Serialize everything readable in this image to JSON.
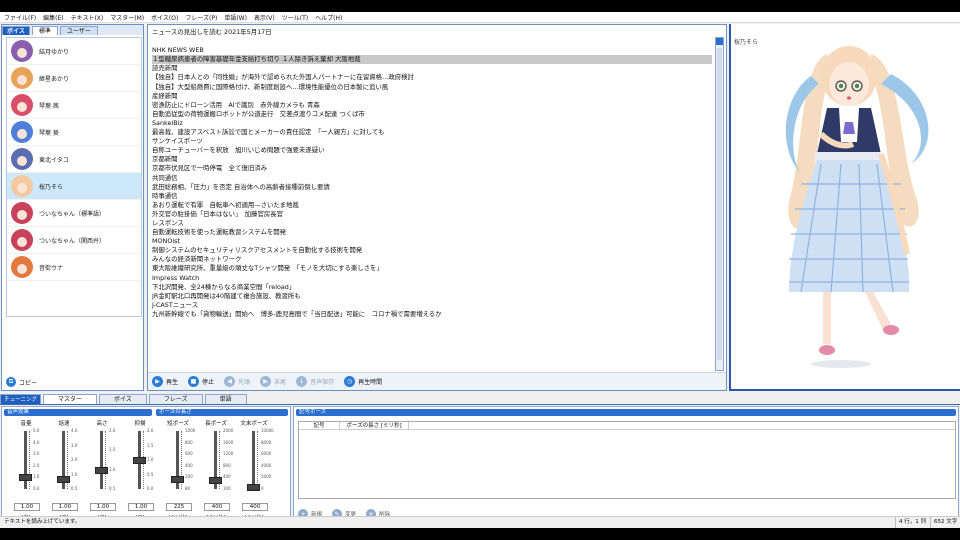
{
  "menu": [
    "ファイル(F)",
    "編集(E)",
    "テキスト(X)",
    "マスター(M)",
    "ボイス(O)",
    "フレーズ(P)",
    "単語(W)",
    "表示(V)",
    "ツール(T)",
    "ヘルプ(H)"
  ],
  "voice_panel": {
    "badge": "ボイス",
    "tabs": [
      "標準",
      "ユーザー"
    ],
    "voices": [
      {
        "name": "結月ゆかり",
        "color": "#8a5fb0"
      },
      {
        "name": "紲星あかり",
        "color": "#e8a35a"
      },
      {
        "name": "琴葉 茜",
        "color": "#d94f6a"
      },
      {
        "name": "琴葉 葵",
        "color": "#4f7fd9"
      },
      {
        "name": "東北イタコ",
        "color": "#5b6fb0"
      },
      {
        "name": "桜乃そら",
        "color": "#f3c9a0",
        "selected": true
      },
      {
        "name": "ついなちゃん（標準語）",
        "color": "#c8405a"
      },
      {
        "name": "ついなちゃん（関西弁）",
        "color": "#c8405a"
      },
      {
        "name": "音街ウナ",
        "color": "#e27a3f"
      }
    ],
    "copy_label": "コピー"
  },
  "editor": {
    "lines": [
      "ニュースの見出しを読む 2021年5月17日",
      "",
      "NHK NEWS WEB",
      "１型糖尿病患者の障害基礎年金支給打ち切り １人除き訴え棄却 大阪地裁",
      "読売新聞",
      "【独自】日本人との「同性婚」が海外で認められた外国人パートナーに在留資格…政府検討",
      "【独自】大型船燃費に国際格付け、新制度創設へ…環境性能優位の日本製に追い風",
      "産経新聞",
      "密漁防止にドローン活用　AIで識別　赤外線カメラも 青森",
      "自動追従型の荷物運搬ロボットが公道走行　交差点渡りコメ配達 つくば市",
      "SankeiBiz",
      "最高裁、建設アスベスト訴訟で国とメーカーの責任認定　「一人親方」に対しても",
      "サンケイスポーツ",
      "自称ユーチューバーを釈放　旭川いじめ問題で強要未遂疑い",
      "京都新聞",
      "京都市伏見区で一時停電　全て復旧済み",
      "共同通信",
      "武田総務相、「圧力」を否定 自治体への高齢者接種前倒し要請",
      "時事通信",
      "あおり運転で有罪　自転車へ初適用—さいたま地裁",
      "外交官の駐掛価「日本はない」　加藤官房長官",
      "レスポンス",
      "自動運転技術を使った運転教習システムを開発",
      "MONOist",
      "制御システムのセキュリティリスクアセスメントを自動化する技術を開発",
      "みんなの経済新聞ネットワーク",
      "東大阪維織研究所、重量級の頑丈なTシャツ開発　「モノを大切にする楽しさを」",
      "Impress Watch",
      "下北沢開発、全24棟からなる商業空間「reload」",
      "JR金町駅北口再開発は40階建て複合施設、教習所も",
      "J-CASTニュース",
      "九州新幹線でも「貨物輸送」開始へ　博多-鹿児島間で「当日配送」可能に　コロナ禍で需要増えるか"
    ],
    "buttons": [
      {
        "label": "再生",
        "icon": "play-icon",
        "glyph": "▶",
        "enabled": true
      },
      {
        "label": "停止",
        "icon": "stop-icon",
        "glyph": "■",
        "enabled": true
      },
      {
        "label": "先頭",
        "icon": "skip-back-icon",
        "glyph": "◀",
        "enabled": false
      },
      {
        "label": "末尾",
        "icon": "skip-forward-icon",
        "glyph": "▶",
        "enabled": false
      },
      {
        "label": "音声保存",
        "icon": "save-audio-icon",
        "glyph": "↓",
        "enabled": false
      },
      {
        "label": "再生時間",
        "icon": "timer-icon",
        "glyph": "◷",
        "enabled": true
      }
    ]
  },
  "character": {
    "name": "桜乃そら"
  },
  "tuning": {
    "badge": "チューニング",
    "tabs": [
      "マスター",
      "ボイス",
      "フレーズ",
      "単語"
    ],
    "section_voice": "音声効果",
    "section_pause": "ポーズの長さ",
    "sliders": [
      {
        "label": "音量",
        "value": "1.00",
        "unit": "[倍]",
        "ticks": [
          "5.0",
          "4.0",
          "3.0",
          "2.0",
          "1.0",
          "0.0"
        ],
        "level": 0.2
      },
      {
        "label": "話速",
        "value": "1.00",
        "unit": "[倍]",
        "ticks": [
          "4.0",
          "3.0",
          "2.0",
          "1.0",
          "0.5"
        ],
        "level": 0.17
      },
      {
        "label": "高さ",
        "value": "1.00",
        "unit": "[倍]",
        "ticks": [
          "2.0",
          "1.5",
          "1.0",
          "0.5"
        ],
        "level": 0.33
      },
      {
        "label": "抑揚",
        "value": "1.00",
        "unit": "[倍]",
        "ticks": [
          "2.0",
          "1.5",
          "1.0",
          "0.5",
          "0.0"
        ],
        "level": 0.5
      },
      {
        "label": "短ポーズ",
        "value": "225",
        "unit": "[ミリ秒]",
        "ticks": [
          "1000",
          "800",
          "600",
          "400",
          "200",
          "80"
        ],
        "level": 0.18
      },
      {
        "label": "長ポーズ",
        "value": "400",
        "unit": "[ミリ秒]",
        "ticks": [
          "2000",
          "1600",
          "1200",
          "800",
          "400",
          "100"
        ],
        "level": 0.16
      },
      {
        "label": "文末ポーズ",
        "value": "400",
        "unit": "[ミリ秒]",
        "ticks": [
          "10000",
          "8000",
          "6000",
          "4000",
          "2000",
          "0"
        ],
        "level": 0.04
      }
    ]
  },
  "pause_symbols": {
    "title": "記号ポーズ",
    "col_symbol": "記号",
    "col_length": "ポーズの長さ [ミリ秒]",
    "buttons": [
      {
        "label": "新規",
        "icon": "new-icon",
        "glyph": "+"
      },
      {
        "label": "変更",
        "icon": "edit-icon",
        "glyph": "✎"
      },
      {
        "label": "削除",
        "icon": "delete-icon",
        "glyph": "✕"
      }
    ]
  },
  "status": {
    "message": "テキストを読み上げています。",
    "position": "4 行，1 列",
    "count": "652 文字"
  }
}
